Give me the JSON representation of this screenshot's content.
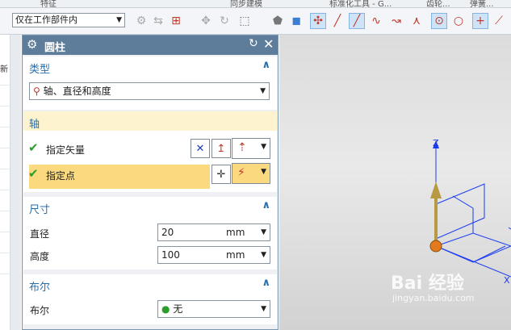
{
  "ribbon": {
    "tabs": [
      "特征",
      "同步建模",
      "标准化工具 - G...",
      "齿轮...",
      "弹簧..."
    ]
  },
  "toolbar": {
    "filter": "仅在工作部件内"
  },
  "left_strip": {
    "label": "新"
  },
  "dialog": {
    "title": "圆柱",
    "type": {
      "header": "类型",
      "value": "轴、直径和高度"
    },
    "axis": {
      "header": "轴",
      "vector_label": "指定矢量",
      "point_label": "指定点"
    },
    "dimensions": {
      "header": "尺寸",
      "diameter_label": "直径",
      "diameter_value": "20",
      "diameter_unit": "mm",
      "height_label": "高度",
      "height_value": "100",
      "height_unit": "mm"
    },
    "boolean": {
      "header": "布尔",
      "label": "布尔",
      "value": "无"
    }
  },
  "viewport": {
    "axis_z": "Z",
    "axis_x": "X",
    "watermark": "Bai 经验",
    "watermark_sub": "jingyan.baidu.com"
  },
  "colors": {
    "title_bar": "#5d7d9a",
    "section_header": "#2a6ea8",
    "point_highlight": "#fbd97e",
    "axis_color": "#1a3cf0",
    "vector_color": "#b89a42"
  }
}
